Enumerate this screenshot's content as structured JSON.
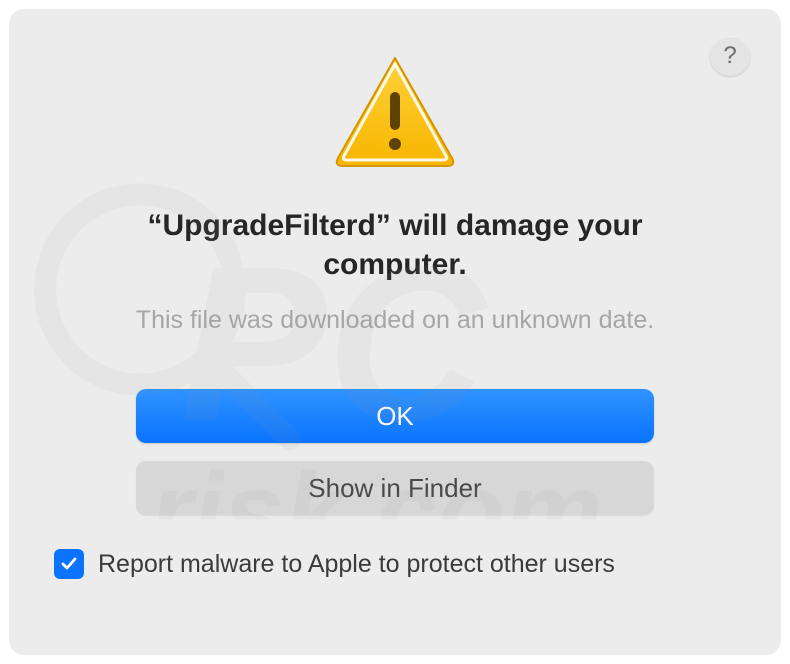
{
  "help": {
    "label": "?"
  },
  "dialog": {
    "title": "“UpgradeFilterd” will damage your computer.",
    "subtitle": "This file was downloaded on an unknown date."
  },
  "buttons": {
    "primary": "OK",
    "secondary": "Show in Finder"
  },
  "checkbox": {
    "label": "Report malware to Apple to protect other users",
    "checked": true
  }
}
